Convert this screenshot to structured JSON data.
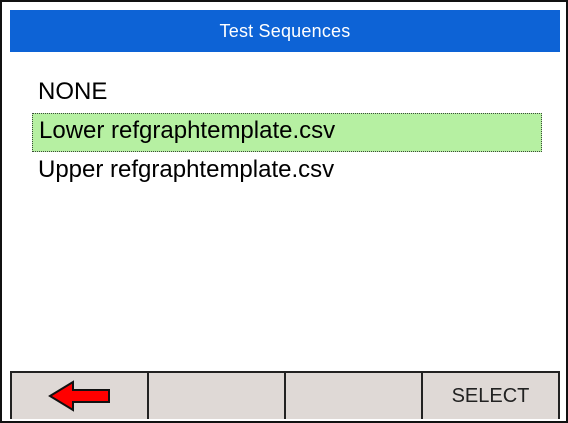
{
  "title": "Test Sequences",
  "sequences": {
    "items": [
      {
        "label": "NONE",
        "selected": false
      },
      {
        "label": "Lower refgraphtemplate.csv",
        "selected": true
      },
      {
        "label": "Upper refgraphtemplate.csv",
        "selected": false
      }
    ]
  },
  "softkeys": {
    "key1_icon": "left-arrow-icon",
    "key2_label": "",
    "key3_label": "",
    "key4_label": "SELECT"
  },
  "colors": {
    "title_background": "#0d63d6",
    "title_text": "#ffffff",
    "selected_row": "#b6f0a2",
    "softkey_background": "#dfd9d6",
    "back_arrow": "#ff0000"
  }
}
